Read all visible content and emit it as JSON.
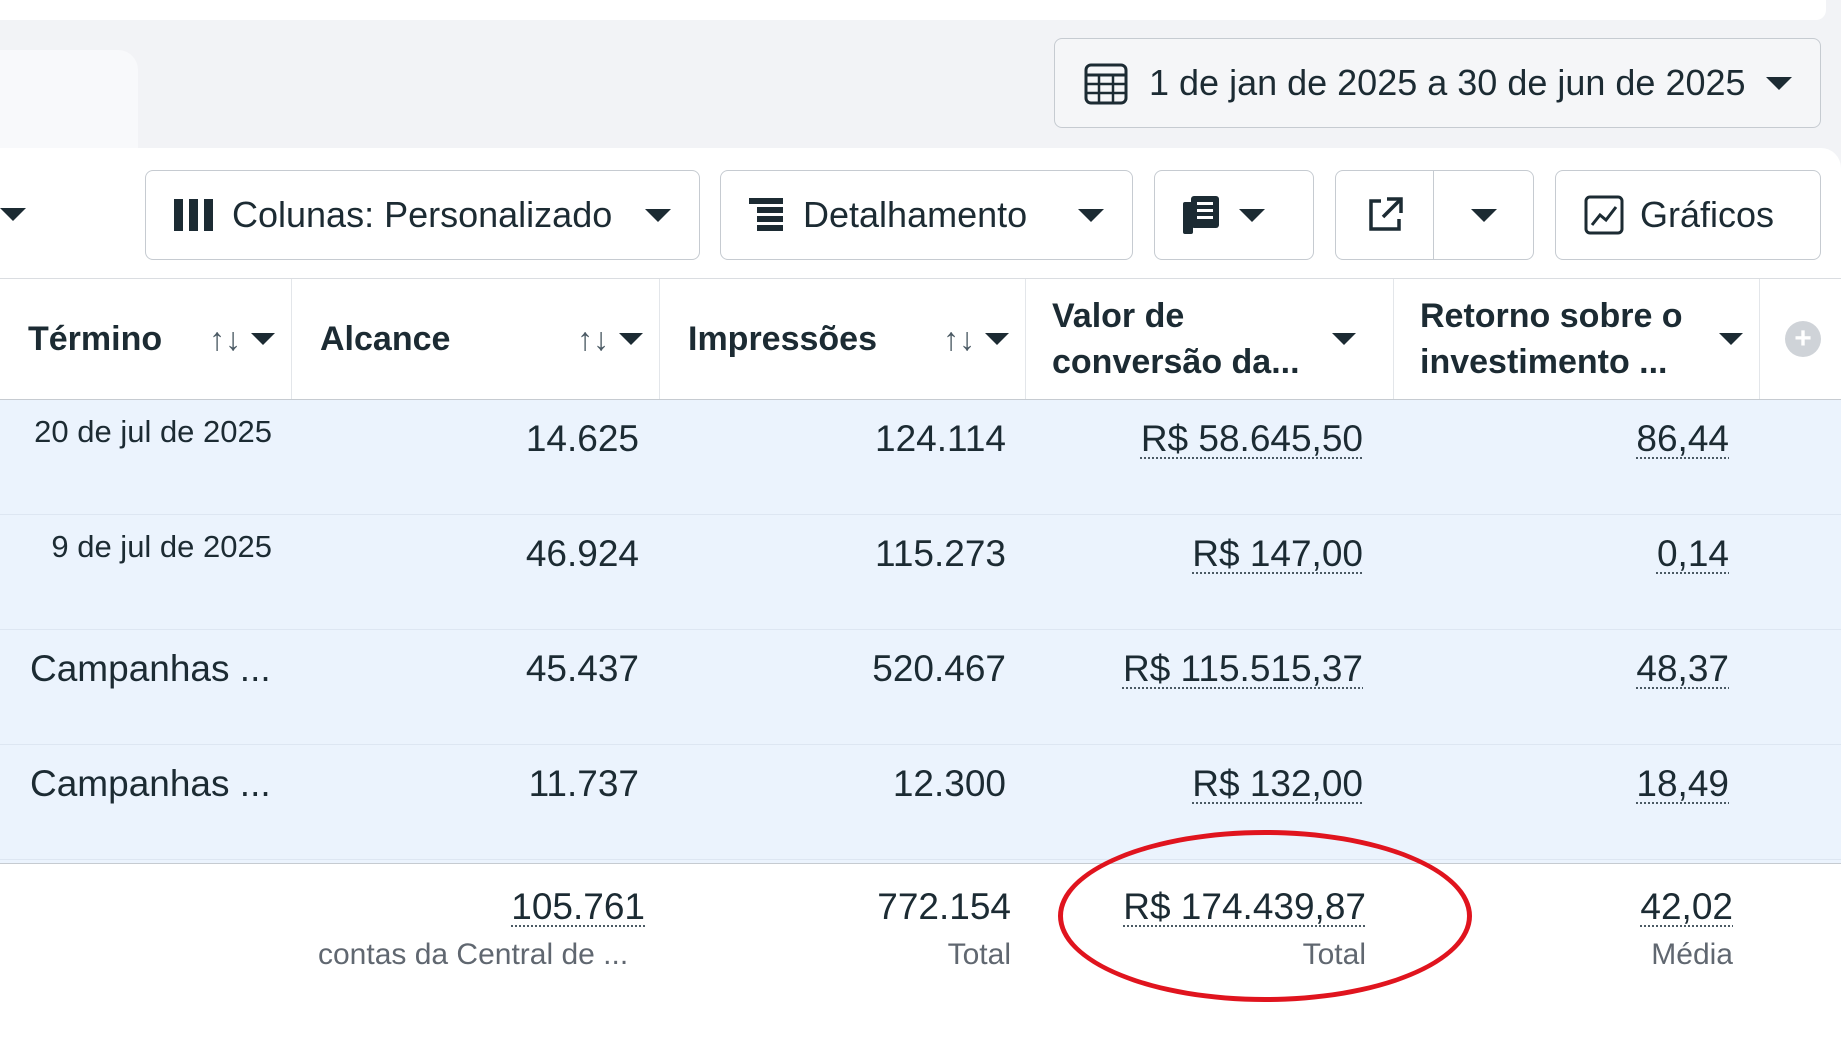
{
  "date_range": {
    "label": "1 de jan de 2025 a 30 de jun de 2025"
  },
  "toolbar": {
    "columns_label": "Colunas: Personalizado",
    "breakdown_label": "Detalhamento",
    "charts_label": "Gráficos"
  },
  "table": {
    "headers": {
      "end": "Término",
      "reach": "Alcance",
      "impressions": "Impressões",
      "conversion_value": "Valor de conversão da...",
      "roas": "Retorno sobre o investimento ..."
    },
    "sort_glyph": "↑↓",
    "rows": [
      {
        "end": "20 de jul de 2025",
        "reach": "14.625",
        "impressions": "124.114",
        "conversion_value": "R$ 58.645,50",
        "roas": "86,44"
      },
      {
        "end": "9 de jul de 2025",
        "reach": "46.924",
        "impressions": "115.273",
        "conversion_value": "R$ 147,00",
        "roas": "0,14"
      },
      {
        "end": "Campanhas ...",
        "reach": "45.437",
        "impressions": "520.467",
        "conversion_value": "R$ 115.515,37",
        "roas": "48,37"
      },
      {
        "end": "Campanhas ...",
        "reach": "11.737",
        "impressions": "12.300",
        "conversion_value": "R$ 132,00",
        "roas": "18,49"
      }
    ],
    "totals": {
      "reach": "105.761",
      "reach_note": "contas da Central de ...",
      "impressions": "772.154",
      "impressions_note": "Total",
      "conversion_value": "R$ 174.439,87",
      "conversion_value_note": "Total",
      "roas": "42,02",
      "roas_note": "Média"
    }
  },
  "colors": {
    "highlight": "#e0141e",
    "row_bg": "#ebf3fd"
  }
}
